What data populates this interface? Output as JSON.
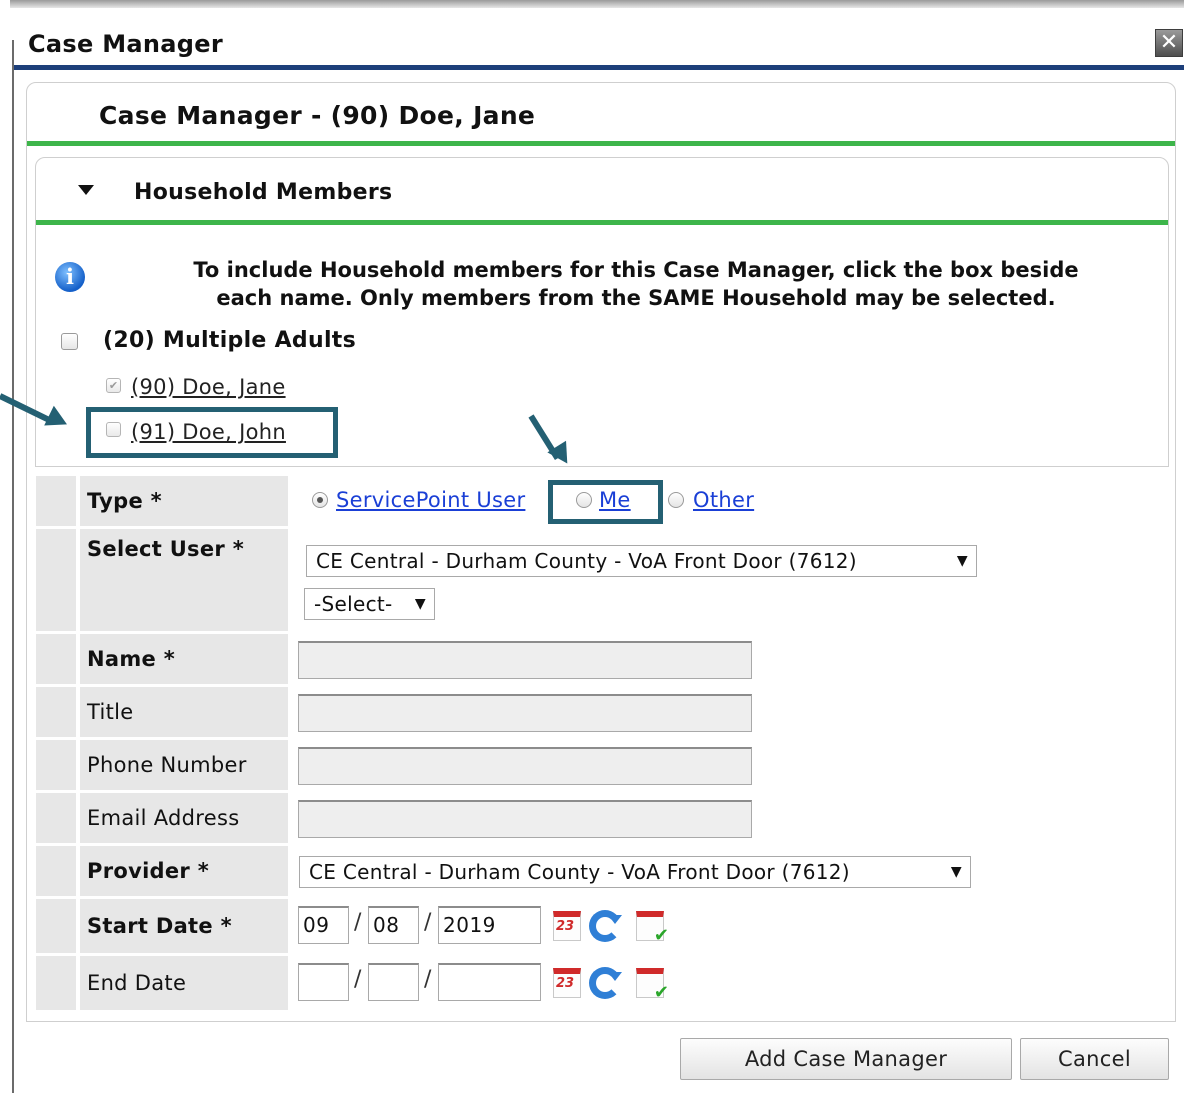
{
  "dialog": {
    "title": "Case Manager",
    "close_symbol": "✕"
  },
  "panel": {
    "title": "Case Manager - (90) Doe, Jane"
  },
  "household": {
    "section_title": "Household Members",
    "info_line1": "To include Household members for this Case Manager, click the box beside",
    "info_line2": "each name. Only members from the SAME Household may be selected.",
    "group_label": "(20) Multiple Adults",
    "members": [
      {
        "label": "(90) Doe, Jane",
        "checked": true,
        "disabled": true
      },
      {
        "label": "(91) Doe, John",
        "checked": false,
        "disabled": false
      }
    ]
  },
  "form": {
    "type": {
      "label": "Type",
      "required_mark": "*",
      "options": [
        "ServicePoint User",
        "Me",
        "Other"
      ],
      "selected": "ServicePoint User"
    },
    "select_user": {
      "label": "Select User",
      "required_mark": "*",
      "provider_value": "CE Central - Durham County - VoA Front Door (7612)",
      "user_value": "-Select-"
    },
    "name": {
      "label": "Name",
      "required_mark": "*",
      "value": ""
    },
    "title": {
      "label": "Title",
      "value": ""
    },
    "phone": {
      "label": "Phone Number",
      "value": ""
    },
    "email": {
      "label": "Email Address",
      "value": ""
    },
    "provider": {
      "label": "Provider",
      "required_mark": "*",
      "value": "CE Central - Durham County - VoA Front Door (7612)"
    },
    "start_date": {
      "label": "Start Date",
      "required_mark": "*",
      "month": "09",
      "day": "08",
      "year": "2019",
      "date_separator": "/"
    },
    "end_date": {
      "label": "End Date",
      "month": "",
      "day": "",
      "year": "",
      "date_separator": "/"
    },
    "caret": "▼",
    "calendar_day_text": "23"
  },
  "buttons": {
    "add_label": "Add Case Manager",
    "cancel_label": "Cancel"
  },
  "colors": {
    "title_rule": "#1d3f7a",
    "section_rule": "#3db54a",
    "annotation": "#246073",
    "link": "#1a3fd6"
  }
}
